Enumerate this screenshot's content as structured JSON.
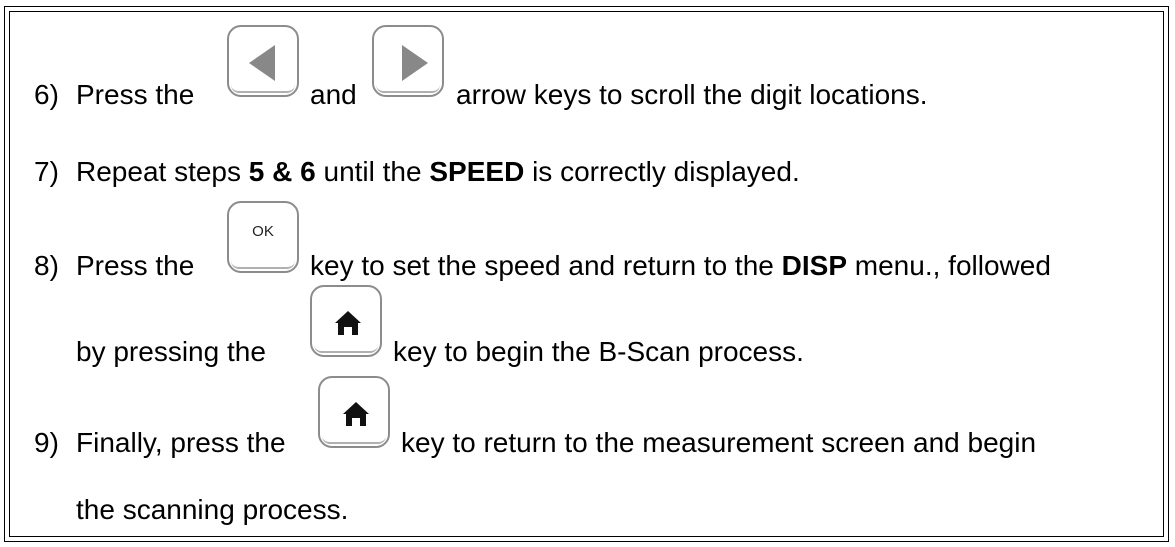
{
  "steps": [
    {
      "number": "6)",
      "parts": [
        "Press the",
        "and",
        "arrow keys to scroll the digit locations."
      ],
      "keys": [
        "left-arrow-icon",
        "right-arrow-icon"
      ]
    },
    {
      "number": "7)",
      "pre": "Repeat steps ",
      "bold1": "5 & 6",
      "mid": " until the ",
      "bold2": "SPEED",
      "post": " is correctly displayed."
    },
    {
      "number": "8)",
      "pre": "Press the",
      "key_label": "OK",
      "mid": "key to set the speed and return to the ",
      "bold": "DISP",
      "post": " menu., followed",
      "line2_pre": "by pressing the",
      "line2_post": "key to begin the B-Scan process.",
      "keys": [
        "ok-key-icon",
        "home-icon"
      ]
    },
    {
      "number": "9)",
      "pre": "Finally, press the",
      "post": "key to return to the measurement screen and begin",
      "line2": "the scanning process.",
      "keys": [
        "home-icon"
      ]
    }
  ],
  "colors": {
    "key_border": "#8c8c8c",
    "icon_fill": "#888888",
    "home_fill": "#111111"
  }
}
